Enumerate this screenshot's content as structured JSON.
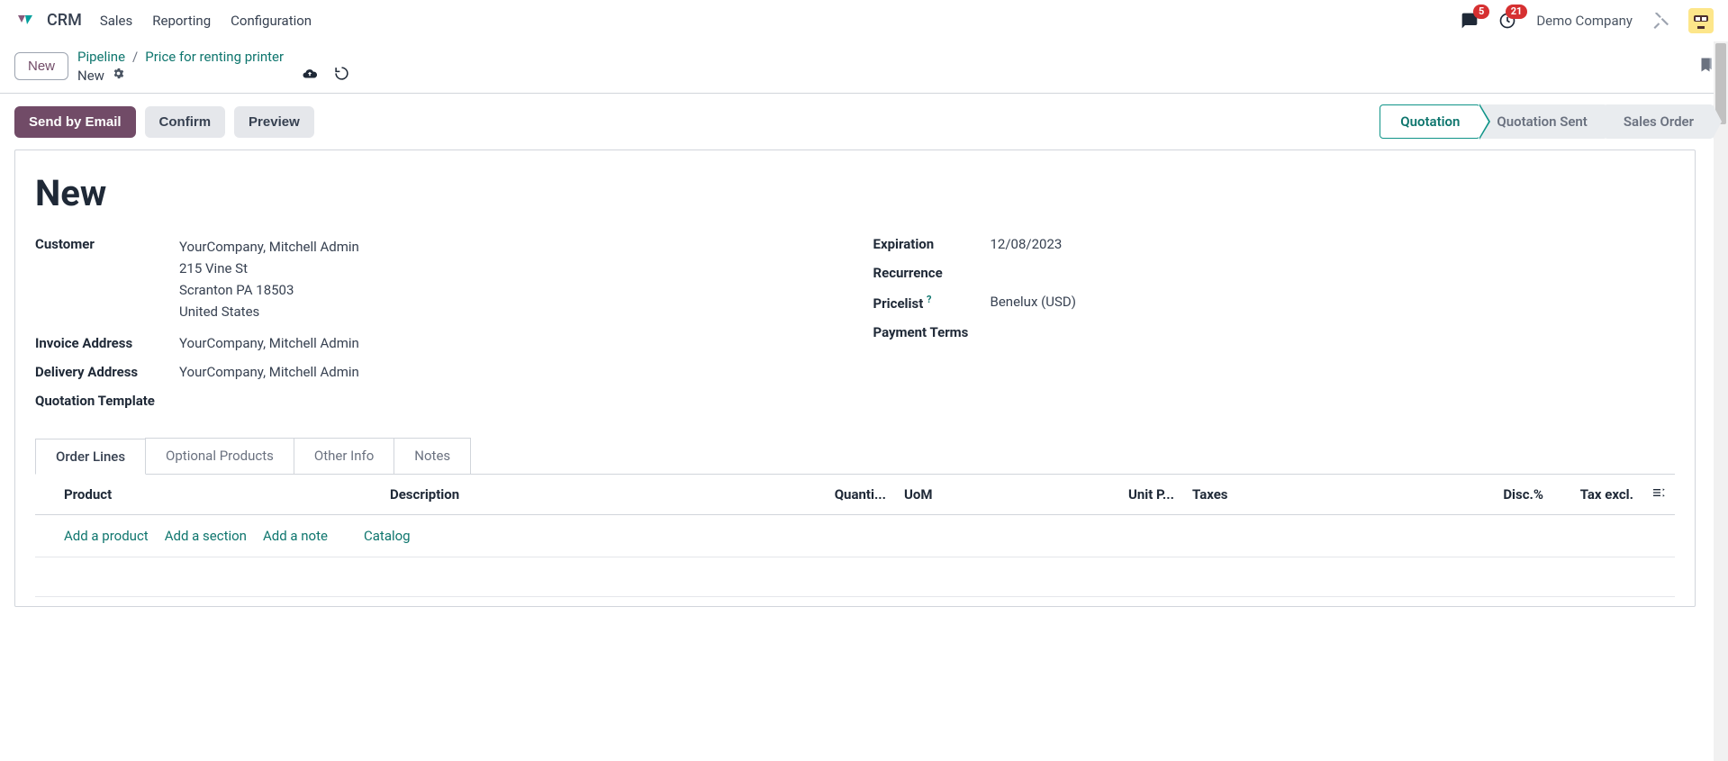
{
  "nav": {
    "app": "CRM",
    "links": [
      "Sales",
      "Reporting",
      "Configuration"
    ],
    "msg_badge": "5",
    "activity_badge": "21",
    "company": "Demo Company"
  },
  "breadcrumb": {
    "new_button": "New",
    "crumb1": "Pipeline",
    "crumb2": "Price for renting printer",
    "current": "New"
  },
  "actions": {
    "send": "Send by Email",
    "confirm": "Confirm",
    "preview": "Preview"
  },
  "stages": {
    "s1": "Quotation",
    "s2": "Quotation Sent",
    "s3": "Sales Order"
  },
  "doc": {
    "title": "New",
    "labels": {
      "customer": "Customer",
      "invoice_addr": "Invoice Address",
      "delivery_addr": "Delivery Address",
      "quote_tmpl": "Quotation Template",
      "expiration": "Expiration",
      "recurrence": "Recurrence",
      "pricelist": "Pricelist",
      "payment_terms": "Payment Terms"
    },
    "customer": {
      "name": "YourCompany, Mitchell Admin",
      "street": "215 Vine St",
      "city": "Scranton PA 18503",
      "country": "United States"
    },
    "invoice_addr": "YourCompany, Mitchell Admin",
    "delivery_addr": "YourCompany, Mitchell Admin",
    "quote_tmpl": "",
    "expiration": "12/08/2023",
    "recurrence": "",
    "pricelist": "Benelux (USD)",
    "payment_terms": ""
  },
  "tabs": {
    "t1": "Order Lines",
    "t2": "Optional Products",
    "t3": "Other Info",
    "t4": "Notes"
  },
  "table": {
    "cols": {
      "product": "Product",
      "desc": "Description",
      "qty": "Quanti...",
      "uom": "UoM",
      "unit_price": "Unit P...",
      "taxes": "Taxes",
      "disc": "Disc.%",
      "tax_excl": "Tax excl."
    },
    "links": {
      "add_product": "Add a product",
      "add_section": "Add a section",
      "add_note": "Add a note",
      "catalog": "Catalog"
    }
  }
}
